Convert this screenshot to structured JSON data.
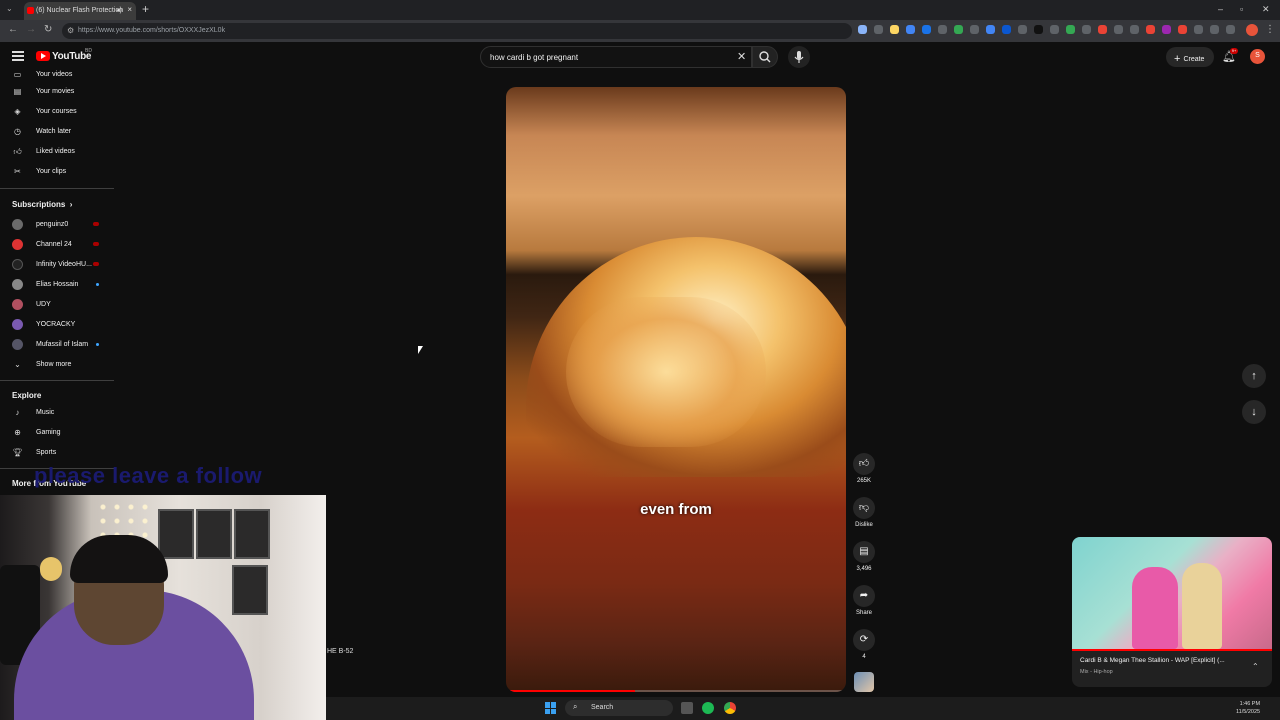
{
  "browser": {
    "tab_title": "(6) Nuclear Flash Protection",
    "new_tab": "+",
    "url": "https://www.youtube.com/shorts/OXXXJezXL0k",
    "controls": {
      "minimize": "–",
      "maximize": "▫",
      "close": "✕"
    }
  },
  "header": {
    "logo": "YouTube",
    "logo_country": "BD",
    "search_value": "how cardi b got pregnant",
    "create_label": "Create",
    "notifications_count": "9+",
    "avatar_letter": "S"
  },
  "sidebar": {
    "you_items": [
      {
        "label": "Your videos",
        "icon": "video-icon"
      },
      {
        "label": "Your movies",
        "icon": "film-icon"
      },
      {
        "label": "Your courses",
        "icon": "courses-icon"
      },
      {
        "label": "Watch later",
        "icon": "clock-icon"
      },
      {
        "label": "Liked videos",
        "icon": "like-icon"
      },
      {
        "label": "Your clips",
        "icon": "scissors-icon"
      }
    ],
    "subscriptions_heading": "Subscriptions",
    "subscriptions": [
      {
        "label": "penguinz0",
        "color": "#6a6a6a"
      },
      {
        "label": "Channel 24",
        "color": "#d33"
      },
      {
        "label": "Infinity VideoHU...",
        "color": "#222"
      },
      {
        "label": "Elias Hossain",
        "color": "#888"
      },
      {
        "label": "UDY",
        "color": "#b05060"
      },
      {
        "label": "YOCRACKY",
        "color": "#7a5ab0"
      },
      {
        "label": "Mufassil of Islam",
        "color": "#556"
      }
    ],
    "show_more": "Show more",
    "explore_heading": "Explore",
    "explore": [
      {
        "label": "Music",
        "icon": "music-icon"
      },
      {
        "label": "Gaming",
        "icon": "gamepad-icon"
      },
      {
        "label": "Sports",
        "icon": "trophy-icon"
      }
    ],
    "more_heading": "More from YouTube"
  },
  "overlay": {
    "stream_text": "please leave a follow",
    "stray_text": "HE B-52"
  },
  "short": {
    "caption": "even from",
    "progress": 0.38
  },
  "actions": {
    "like_count": "265K",
    "dislike_label": "Dislike",
    "comment_count": "3,496",
    "share_label": "Share",
    "remix_count": "4"
  },
  "mini_player": {
    "title": "Cardi B & Megan Thee Stallion - WAP [Explicit] (...",
    "subtitle": "Mix - Hip-hop"
  },
  "taskbar": {
    "search_label": "Search",
    "time": "1:46 PM",
    "date": "11/5/2025"
  }
}
